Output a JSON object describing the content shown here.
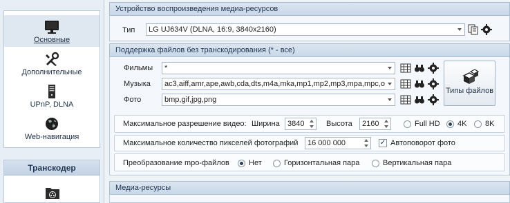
{
  "nav": {
    "items": [
      {
        "label": "Основные",
        "icon": "monitor-icon"
      },
      {
        "label": "Дополнительные",
        "icon": "tools-icon"
      },
      {
        "label": "UPnP, DLNA",
        "icon": "server-icon"
      },
      {
        "label": "Web-навигация",
        "icon": "globe-icon"
      }
    ],
    "active": "Основные",
    "transcoder": {
      "title": "Транскодер",
      "icon": "film-folder-icon"
    }
  },
  "device_section": {
    "title": "Устройство воспроизведения медиа-ресурсов",
    "type_label": "Тип",
    "type_value": "LG UJ634V (DLNA, 16:9, 3840x2160)"
  },
  "formats_section": {
    "title": "Поддержка файлов без транскодирования (* - все)",
    "rows": [
      {
        "label": "Фильмы",
        "value": "*"
      },
      {
        "label": "Музыка",
        "value": "ac3,aiff,amr,ape,awb,cda,dts,m4a,mka,mp1,mp2,mp3,mpa,mpc,o"
      },
      {
        "label": "Фото",
        "value": "bmp,gif,jpg,png"
      }
    ],
    "file_types_button": "Типы файлов",
    "max_res_label": "Максимальное разрешение видео:",
    "width_label": "Ширина",
    "width_value": "3840",
    "height_label": "Высота",
    "height_value": "2160",
    "res_options": [
      "Full HD",
      "4K",
      "8K"
    ],
    "res_selected": "4K",
    "max_pixels_label": "Максимальное количество пикселей фотографий",
    "max_pixels_value": "16 000 000",
    "autorotate_label": "Автоповорот фото",
    "autorotate_checked": true,
    "mpo_label": "Преобразование mpo-файлов",
    "mpo_options": [
      "Нет",
      "Горизонтальная пара",
      "Вертикальная пара"
    ],
    "mpo_selected": "Нет"
  },
  "media_section": {
    "title": "Медиа-ресурсы"
  },
  "colors": {
    "header_bg": "#c9d7e7",
    "panel_border": "#b9c7d6",
    "text_dark": "#1f3552"
  }
}
